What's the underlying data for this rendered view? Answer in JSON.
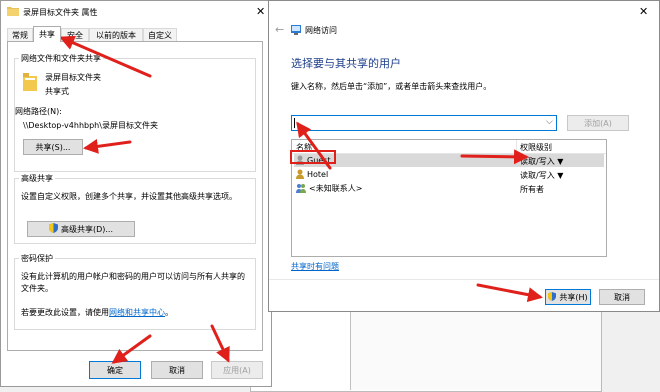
{
  "props": {
    "title": "录屏目标文件夹 属性",
    "tabs": [
      "常规",
      "共享",
      "安全",
      "以前的版本",
      "自定义"
    ],
    "share_group_title": "网络文件和文件夹共享",
    "folder_name": "录屏目标文件夹",
    "folder_status": "共享式",
    "netpath_label": "网络路径(N):",
    "netpath_value": "\\\\Desktop-v4hhbph\\录屏目标文件夹",
    "share_button": "共享(S)...",
    "adv_group_title": "高级共享",
    "adv_desc": "设置自定义权限，创建多个共享，并设置其他高级共享选项。",
    "adv_button": "高级共享(D)...",
    "pwd_group_title": "密码保护",
    "pwd_desc": "没有此计算机的用户帐户和密码的用户可以访问与所有人共享的文件夹。",
    "pwd_change_prefix": "若要更改此设置，请使用",
    "pwd_change_link": "网络和共享中心",
    "pwd_change_suffix": "。",
    "ok": "确定",
    "cancel": "取消",
    "apply": "应用(A)"
  },
  "wizard": {
    "title": "网络访问",
    "heading": "选择要与其共享的用户",
    "instruction": "键入名称，然后单击“添加”，或者单击箭头来查找用户。",
    "input_value": "",
    "add_button": "添加(A)",
    "col_name": "名称",
    "col_perm": "权限级别",
    "users": [
      {
        "name": "Guest",
        "perm": "读取/写入 ▼"
      },
      {
        "name": "Hotel",
        "perm": "读取/写入 ▼"
      },
      {
        "name": "<未知联系人>",
        "perm": "所有者"
      }
    ],
    "trouble_link": "共享时有问题",
    "share_button": "共享(H)",
    "cancel_button": "取消"
  },
  "colors": {
    "accent": "#0078d7",
    "arrow": "#e0201b",
    "link": "#0066cc"
  }
}
